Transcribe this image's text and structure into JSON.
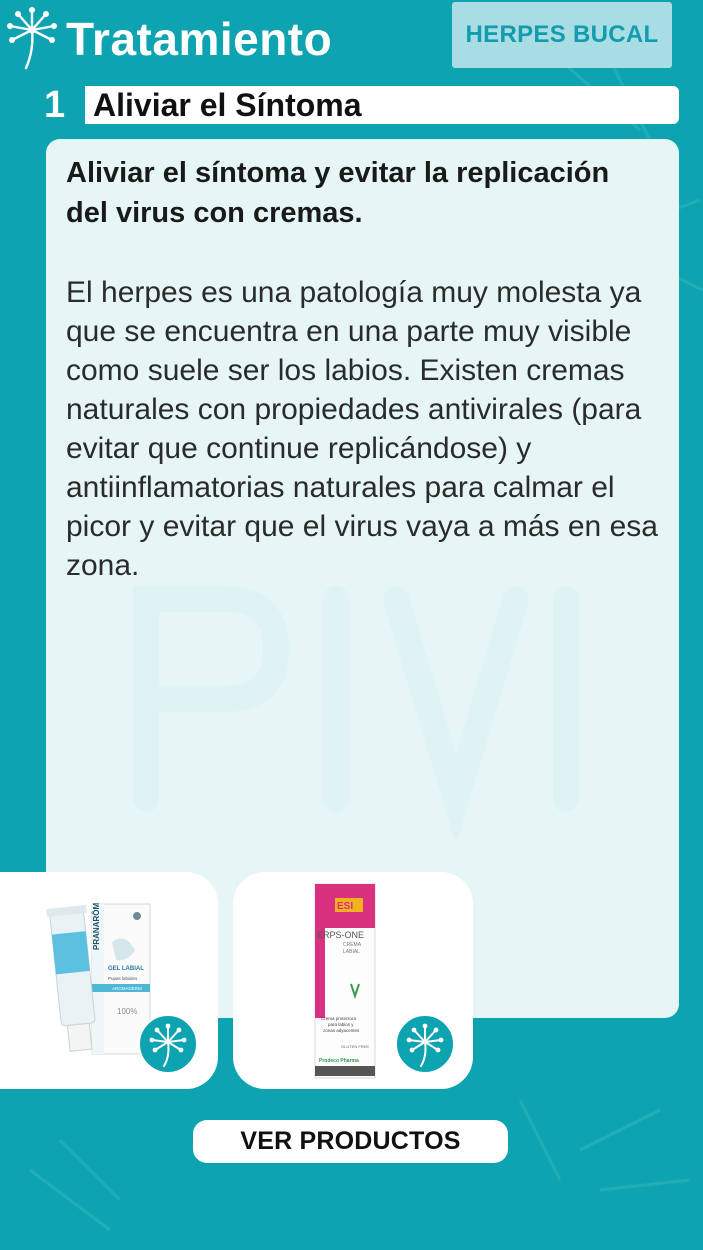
{
  "header": {
    "title": "Tratamiento",
    "category": "HERPES BUCAL"
  },
  "step": {
    "number": "1",
    "title": "Aliviar el Síntoma"
  },
  "content": {
    "lead": "Aliviar el síntoma y evitar la replicación del virus con cremas.",
    "body": "El herpes es una patología muy molesta ya que se encuentra en una parte muy visible como suele ser los labios. Existen cremas naturales con propiedades antivirales (para evitar que continue replicándose) y antiinflamatorias naturales para calmar el picor y evitar que el virus vaya a más en esa zona."
  },
  "products": [
    {
      "brand": "PRANARÔM",
      "line1": "GEL LABIAL",
      "line2": "Pupas labiales",
      "line3": "AROMADERM",
      "line4": "100%",
      "icon": "dandelion-icon"
    },
    {
      "brand": "ESI",
      "name": "ERPS-ONE",
      "sub1": "CREMA",
      "sub2": "LABIAL",
      "desc1": "Crema protectora",
      "desc2": "para labios y",
      "desc3": "zonas adyacentes",
      "gluten": "GLUTEN FREE",
      "maker": "Prodeco Pharma",
      "icon": "dandelion-icon"
    }
  ],
  "cta": {
    "label": "VER PRODUCTOS"
  },
  "colors": {
    "background": "#0ea3b1",
    "tag_bg": "#a9dde4",
    "card_bg": "#e6f6f7",
    "accent_pink": "#d9307f"
  }
}
